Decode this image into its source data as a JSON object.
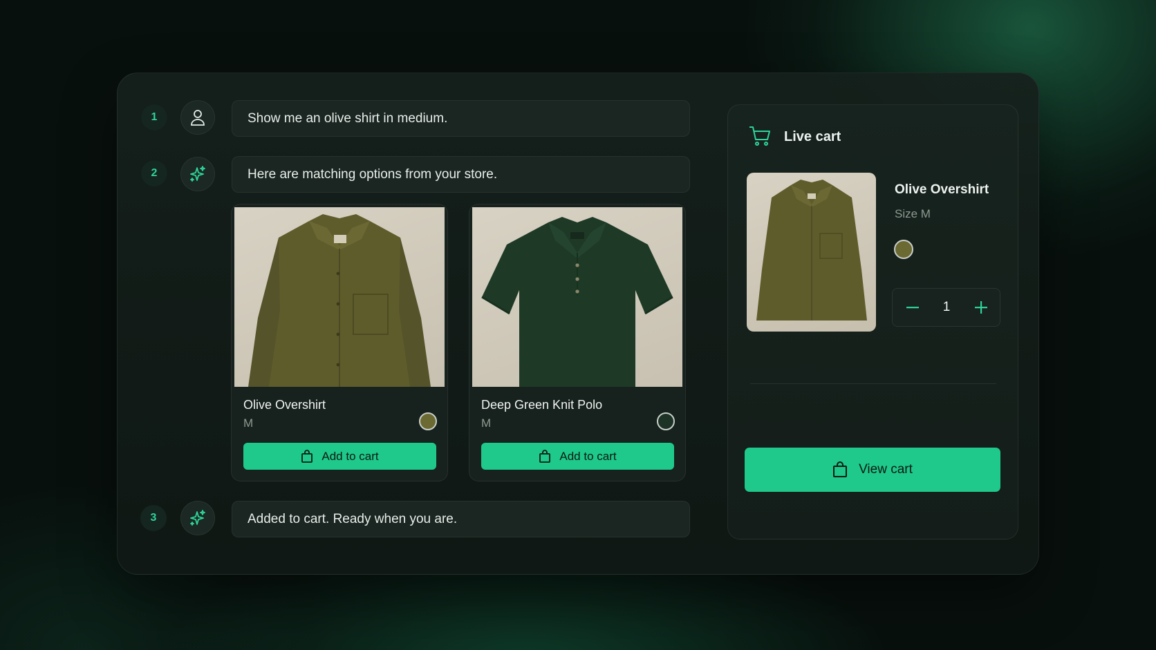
{
  "chat": {
    "steps": [
      {
        "num": "1",
        "avatar": "user-icon",
        "text": "Show me an olive shirt in medium."
      },
      {
        "num": "2",
        "avatar": "sparkle-icon",
        "text": "Here are matching options from your store."
      },
      {
        "num": "3",
        "avatar": "sparkle-icon",
        "text": "Added to cart. Ready when you are."
      }
    ],
    "products": [
      {
        "name": "Olive Overshirt",
        "size": "M",
        "swatch_color": "#6b6a32",
        "button": "Add to cart"
      },
      {
        "name": "Deep Green Knit Polo",
        "size": "M",
        "swatch_color": "#1c3325",
        "button": "Add to cart"
      }
    ]
  },
  "cart": {
    "title": "Live cart",
    "item": {
      "name": "Olive Overshirt",
      "size": "Size M",
      "swatch_color": "#6b6a32",
      "quantity": "1"
    },
    "view_button": "View cart"
  },
  "colors": {
    "accent": "#1fc98b",
    "accent_text": "#2fd49a",
    "background": "#08100d"
  }
}
